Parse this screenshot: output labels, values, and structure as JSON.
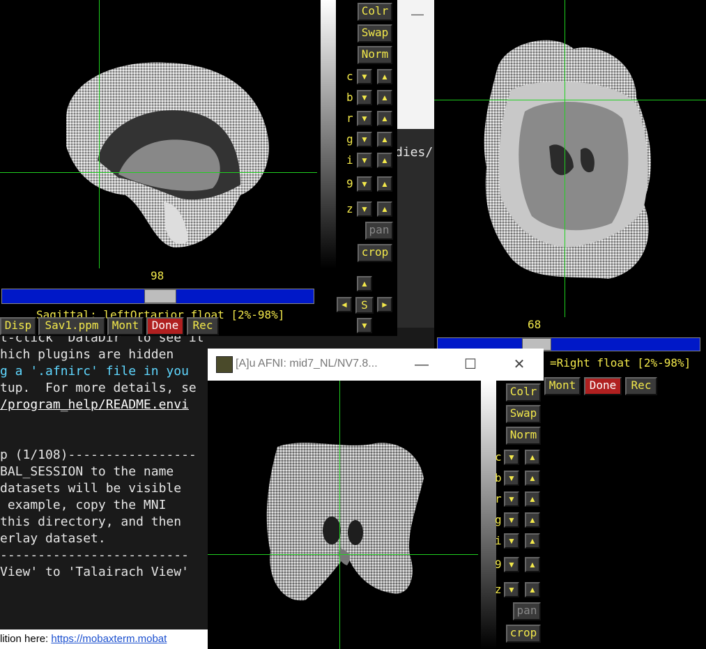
{
  "terminal": {
    "lines": [
      "t-click 'DataDir' to see it",
      "hich plugins are hidden",
      "g a '.afnirc' file in you",
      "tup.  For more details, se",
      "/program_help/README.envi",
      "",
      "p (1/108)-----------------",
      "BAL_SESSION to the name",
      "datasets will be visible",
      " example, copy the MNI",
      "this directory, and then",
      "erlay dataset.",
      "-------------------------",
      "View' to 'Talairach View'"
    ],
    "bg_text": "dies/",
    "footer_prefix": "lition here:",
    "footer_link": "https://mobaxterm.mobat"
  },
  "sagittal": {
    "slice": "98",
    "info": "Sagittal: leftOrtarior float [2%-98%]",
    "buttons": {
      "disp": "Disp",
      "save": "Sav1.ppm",
      "mont": "Mont",
      "done": "Done",
      "rec": "Rec"
    },
    "controls": {
      "colr": "Colr",
      "swap": "Swap",
      "norm": "Norm",
      "pan": "pan",
      "crop": "crop",
      "s": "S"
    },
    "labels": [
      "c",
      "b",
      "r",
      "g",
      "i",
      "9",
      "z"
    ],
    "slider_fraction": 0.51
  },
  "axial": {
    "slice": "68",
    "info": "=Right float [2%-98%]",
    "buttons": {
      "mont": "Mont",
      "done": "Done",
      "rec": "Rec"
    },
    "slider_fraction": 0.38
  },
  "coronal": {
    "window_title": "[A]u AFNI: mid7_NL/NV7.8...",
    "controls": {
      "colr": "Colr",
      "swap": "Swap",
      "norm": "Norm",
      "pan": "pan",
      "crop": "crop"
    },
    "labels": [
      "c",
      "b",
      "r",
      "g",
      "i",
      "9",
      "z"
    ]
  },
  "colors": {
    "accent": "#f3e94b",
    "crosshair": "#20d020",
    "slider": "#0018c8",
    "done": "#b02020"
  }
}
